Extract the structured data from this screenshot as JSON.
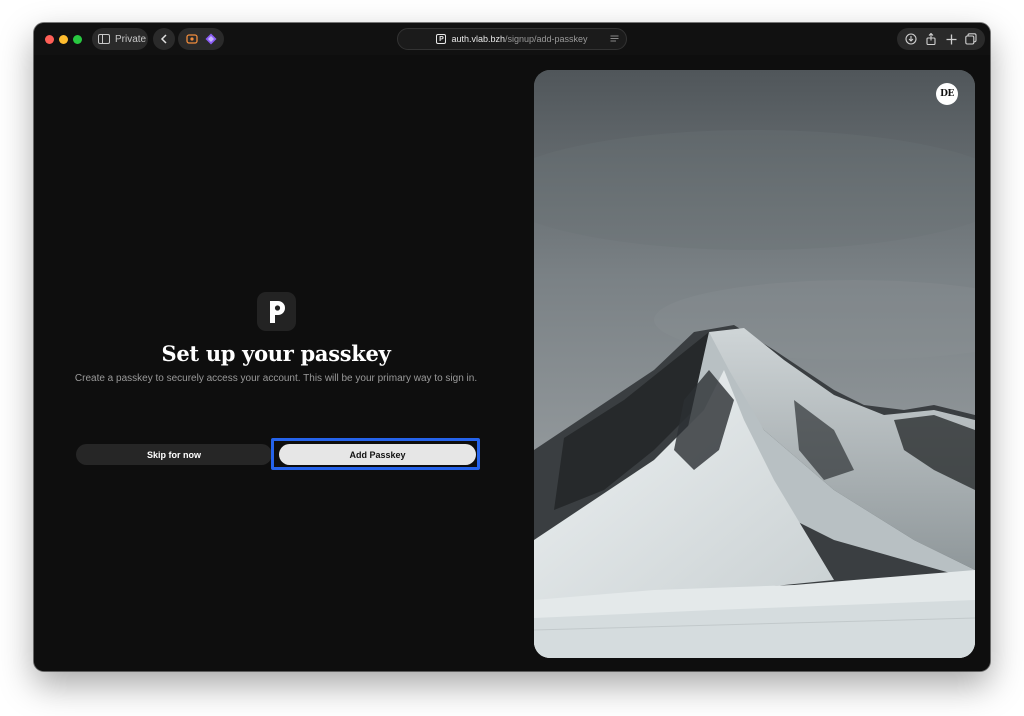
{
  "browser": {
    "private_label": "Private",
    "url_host": "auth.vlab.bzh",
    "url_path": "/signup/add-passkey",
    "favicon_letter": "P"
  },
  "page": {
    "heading": "Set up your passkey",
    "subtitle": "Create a passkey to securely access your account. This will be your primary way to sign in.",
    "skip_label": "Skip for now",
    "add_label": "Add Passkey",
    "badge": "DE"
  },
  "colors": {
    "highlight": "#2563eb",
    "background": "#0e0e0e",
    "primary_button": "#e6e6e6"
  },
  "icons": [
    "sidebar-icon",
    "back-chevron-icon",
    "extension-icon",
    "download-icon",
    "share-icon",
    "plus-icon",
    "tabs-icon",
    "reader-icon"
  ]
}
